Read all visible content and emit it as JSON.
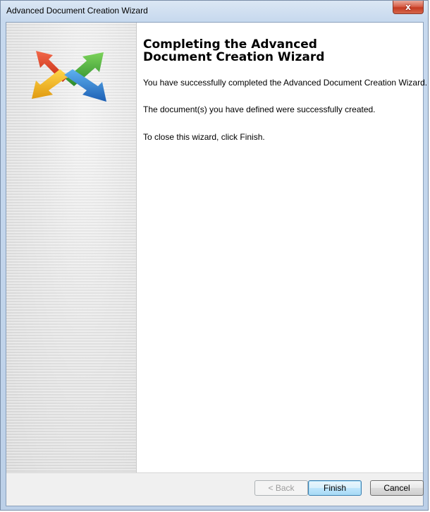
{
  "window": {
    "title": "Advanced Document Creation Wizard",
    "close_label": "x"
  },
  "content": {
    "heading": "Completing the Advanced\nDocument Creation Wizard",
    "paragraphs": [
      "You have successfully completed the Advanced Document Creation Wizard.",
      "The document(s) you have defined were successfully created.",
      "To close this wizard, click Finish."
    ]
  },
  "buttons": {
    "back": "< Back",
    "finish": "Finish",
    "cancel": "Cancel"
  },
  "colors": {
    "arrow_red": "#e03a1e",
    "arrow_green": "#3aa23a",
    "arrow_yellow": "#f0b21a",
    "arrow_blue": "#2f7fd0"
  }
}
